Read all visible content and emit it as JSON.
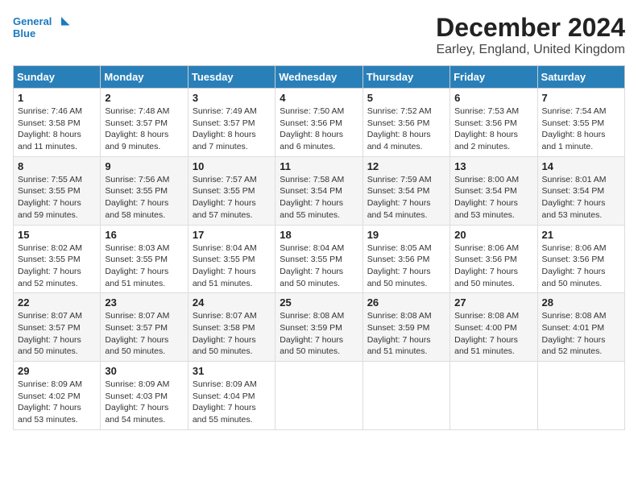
{
  "header": {
    "logo_line1": "General",
    "logo_line2": "Blue",
    "title": "December 2024",
    "subtitle": "Earley, England, United Kingdom"
  },
  "days_of_week": [
    "Sunday",
    "Monday",
    "Tuesday",
    "Wednesday",
    "Thursday",
    "Friday",
    "Saturday"
  ],
  "weeks": [
    [
      {
        "day": "1",
        "sunrise": "7:46 AM",
        "sunset": "3:58 PM",
        "daylight": "8 hours and 11 minutes."
      },
      {
        "day": "2",
        "sunrise": "7:48 AM",
        "sunset": "3:57 PM",
        "daylight": "8 hours and 9 minutes."
      },
      {
        "day": "3",
        "sunrise": "7:49 AM",
        "sunset": "3:57 PM",
        "daylight": "8 hours and 7 minutes."
      },
      {
        "day": "4",
        "sunrise": "7:50 AM",
        "sunset": "3:56 PM",
        "daylight": "8 hours and 6 minutes."
      },
      {
        "day": "5",
        "sunrise": "7:52 AM",
        "sunset": "3:56 PM",
        "daylight": "8 hours and 4 minutes."
      },
      {
        "day": "6",
        "sunrise": "7:53 AM",
        "sunset": "3:56 PM",
        "daylight": "8 hours and 2 minutes."
      },
      {
        "day": "7",
        "sunrise": "7:54 AM",
        "sunset": "3:55 PM",
        "daylight": "8 hours and 1 minute."
      }
    ],
    [
      {
        "day": "8",
        "sunrise": "7:55 AM",
        "sunset": "3:55 PM",
        "daylight": "7 hours and 59 minutes."
      },
      {
        "day": "9",
        "sunrise": "7:56 AM",
        "sunset": "3:55 PM",
        "daylight": "7 hours and 58 minutes."
      },
      {
        "day": "10",
        "sunrise": "7:57 AM",
        "sunset": "3:55 PM",
        "daylight": "7 hours and 57 minutes."
      },
      {
        "day": "11",
        "sunrise": "7:58 AM",
        "sunset": "3:54 PM",
        "daylight": "7 hours and 55 minutes."
      },
      {
        "day": "12",
        "sunrise": "7:59 AM",
        "sunset": "3:54 PM",
        "daylight": "7 hours and 54 minutes."
      },
      {
        "day": "13",
        "sunrise": "8:00 AM",
        "sunset": "3:54 PM",
        "daylight": "7 hours and 53 minutes."
      },
      {
        "day": "14",
        "sunrise": "8:01 AM",
        "sunset": "3:54 PM",
        "daylight": "7 hours and 53 minutes."
      }
    ],
    [
      {
        "day": "15",
        "sunrise": "8:02 AM",
        "sunset": "3:55 PM",
        "daylight": "7 hours and 52 minutes."
      },
      {
        "day": "16",
        "sunrise": "8:03 AM",
        "sunset": "3:55 PM",
        "daylight": "7 hours and 51 minutes."
      },
      {
        "day": "17",
        "sunrise": "8:04 AM",
        "sunset": "3:55 PM",
        "daylight": "7 hours and 51 minutes."
      },
      {
        "day": "18",
        "sunrise": "8:04 AM",
        "sunset": "3:55 PM",
        "daylight": "7 hours and 50 minutes."
      },
      {
        "day": "19",
        "sunrise": "8:05 AM",
        "sunset": "3:56 PM",
        "daylight": "7 hours and 50 minutes."
      },
      {
        "day": "20",
        "sunrise": "8:06 AM",
        "sunset": "3:56 PM",
        "daylight": "7 hours and 50 minutes."
      },
      {
        "day": "21",
        "sunrise": "8:06 AM",
        "sunset": "3:56 PM",
        "daylight": "7 hours and 50 minutes."
      }
    ],
    [
      {
        "day": "22",
        "sunrise": "8:07 AM",
        "sunset": "3:57 PM",
        "daylight": "7 hours and 50 minutes."
      },
      {
        "day": "23",
        "sunrise": "8:07 AM",
        "sunset": "3:57 PM",
        "daylight": "7 hours and 50 minutes."
      },
      {
        "day": "24",
        "sunrise": "8:07 AM",
        "sunset": "3:58 PM",
        "daylight": "7 hours and 50 minutes."
      },
      {
        "day": "25",
        "sunrise": "8:08 AM",
        "sunset": "3:59 PM",
        "daylight": "7 hours and 50 minutes."
      },
      {
        "day": "26",
        "sunrise": "8:08 AM",
        "sunset": "3:59 PM",
        "daylight": "7 hours and 51 minutes."
      },
      {
        "day": "27",
        "sunrise": "8:08 AM",
        "sunset": "4:00 PM",
        "daylight": "7 hours and 51 minutes."
      },
      {
        "day": "28",
        "sunrise": "8:08 AM",
        "sunset": "4:01 PM",
        "daylight": "7 hours and 52 minutes."
      }
    ],
    [
      {
        "day": "29",
        "sunrise": "8:09 AM",
        "sunset": "4:02 PM",
        "daylight": "7 hours and 53 minutes."
      },
      {
        "day": "30",
        "sunrise": "8:09 AM",
        "sunset": "4:03 PM",
        "daylight": "7 hours and 54 minutes."
      },
      {
        "day": "31",
        "sunrise": "8:09 AM",
        "sunset": "4:04 PM",
        "daylight": "7 hours and 55 minutes."
      },
      null,
      null,
      null,
      null
    ]
  ],
  "labels": {
    "sunrise": "Sunrise:",
    "sunset": "Sunset:",
    "daylight": "Daylight:"
  }
}
